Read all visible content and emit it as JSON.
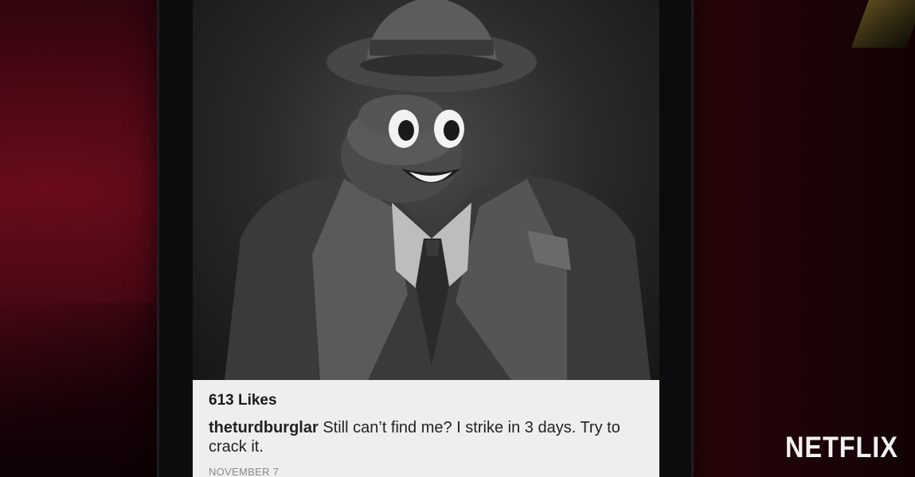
{
  "post": {
    "likes": "613 Likes",
    "username": "theturdburglar",
    "text": "Still can’t find me? I strike in 3 days. Try to crack it.",
    "date": "NOVEMBER 7"
  },
  "image": {
    "subject_icon": "poop-emoji-detective-icon"
  },
  "watermark": "NETFLIX",
  "colors": {
    "background": "#3c0610",
    "caption_bg": "#eeeeee",
    "phone_bezel": "#0c0c0e"
  }
}
